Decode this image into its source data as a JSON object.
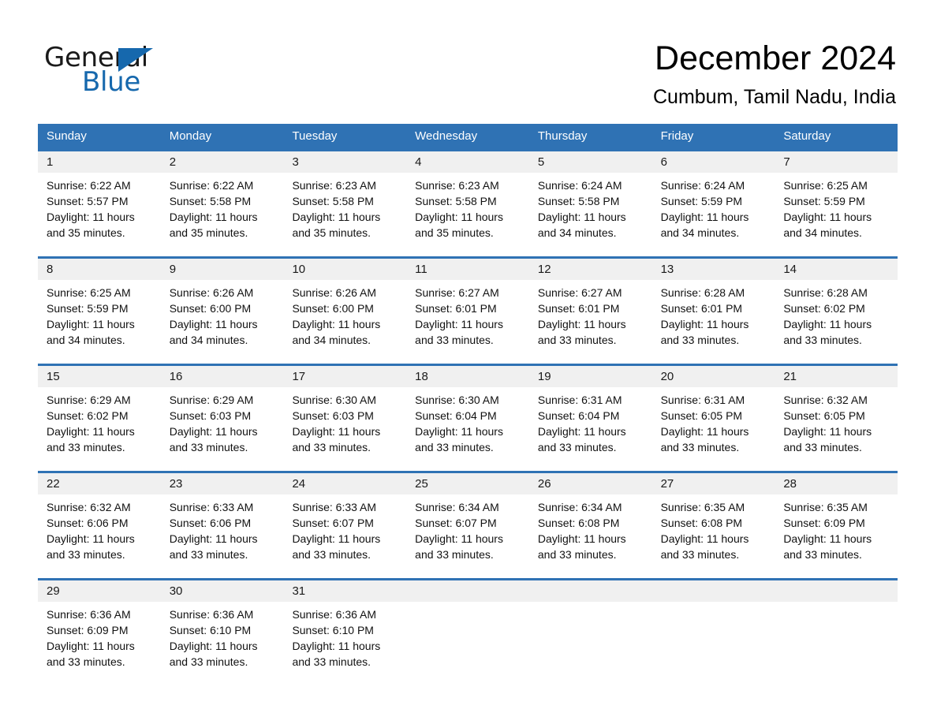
{
  "brand": {
    "name_part1": "General",
    "name_part2": "Blue",
    "triangle_color": "#1668ad"
  },
  "header": {
    "month_title": "December 2024",
    "location": "Cumbum, Tamil Nadu, India"
  },
  "theme": {
    "header_blue": "#2f72b4",
    "date_band_gray": "#f0f0f0",
    "row_divider_blue": "#2f72b4",
    "page_background": "#ffffff"
  },
  "weekdays": [
    "Sunday",
    "Monday",
    "Tuesday",
    "Wednesday",
    "Thursday",
    "Friday",
    "Saturday"
  ],
  "weeks": [
    {
      "days": [
        {
          "date": "1",
          "sunrise": "Sunrise: 6:22 AM",
          "sunset": "Sunset: 5:57 PM",
          "daylight_line1": "Daylight: 11 hours",
          "daylight_line2": "and 35 minutes."
        },
        {
          "date": "2",
          "sunrise": "Sunrise: 6:22 AM",
          "sunset": "Sunset: 5:58 PM",
          "daylight_line1": "Daylight: 11 hours",
          "daylight_line2": "and 35 minutes."
        },
        {
          "date": "3",
          "sunrise": "Sunrise: 6:23 AM",
          "sunset": "Sunset: 5:58 PM",
          "daylight_line1": "Daylight: 11 hours",
          "daylight_line2": "and 35 minutes."
        },
        {
          "date": "4",
          "sunrise": "Sunrise: 6:23 AM",
          "sunset": "Sunset: 5:58 PM",
          "daylight_line1": "Daylight: 11 hours",
          "daylight_line2": "and 35 minutes."
        },
        {
          "date": "5",
          "sunrise": "Sunrise: 6:24 AM",
          "sunset": "Sunset: 5:58 PM",
          "daylight_line1": "Daylight: 11 hours",
          "daylight_line2": "and 34 minutes."
        },
        {
          "date": "6",
          "sunrise": "Sunrise: 6:24 AM",
          "sunset": "Sunset: 5:59 PM",
          "daylight_line1": "Daylight: 11 hours",
          "daylight_line2": "and 34 minutes."
        },
        {
          "date": "7",
          "sunrise": "Sunrise: 6:25 AM",
          "sunset": "Sunset: 5:59 PM",
          "daylight_line1": "Daylight: 11 hours",
          "daylight_line2": "and 34 minutes."
        }
      ]
    },
    {
      "days": [
        {
          "date": "8",
          "sunrise": "Sunrise: 6:25 AM",
          "sunset": "Sunset: 5:59 PM",
          "daylight_line1": "Daylight: 11 hours",
          "daylight_line2": "and 34 minutes."
        },
        {
          "date": "9",
          "sunrise": "Sunrise: 6:26 AM",
          "sunset": "Sunset: 6:00 PM",
          "daylight_line1": "Daylight: 11 hours",
          "daylight_line2": "and 34 minutes."
        },
        {
          "date": "10",
          "sunrise": "Sunrise: 6:26 AM",
          "sunset": "Sunset: 6:00 PM",
          "daylight_line1": "Daylight: 11 hours",
          "daylight_line2": "and 34 minutes."
        },
        {
          "date": "11",
          "sunrise": "Sunrise: 6:27 AM",
          "sunset": "Sunset: 6:01 PM",
          "daylight_line1": "Daylight: 11 hours",
          "daylight_line2": "and 33 minutes."
        },
        {
          "date": "12",
          "sunrise": "Sunrise: 6:27 AM",
          "sunset": "Sunset: 6:01 PM",
          "daylight_line1": "Daylight: 11 hours",
          "daylight_line2": "and 33 minutes."
        },
        {
          "date": "13",
          "sunrise": "Sunrise: 6:28 AM",
          "sunset": "Sunset: 6:01 PM",
          "daylight_line1": "Daylight: 11 hours",
          "daylight_line2": "and 33 minutes."
        },
        {
          "date": "14",
          "sunrise": "Sunrise: 6:28 AM",
          "sunset": "Sunset: 6:02 PM",
          "daylight_line1": "Daylight: 11 hours",
          "daylight_line2": "and 33 minutes."
        }
      ]
    },
    {
      "days": [
        {
          "date": "15",
          "sunrise": "Sunrise: 6:29 AM",
          "sunset": "Sunset: 6:02 PM",
          "daylight_line1": "Daylight: 11 hours",
          "daylight_line2": "and 33 minutes."
        },
        {
          "date": "16",
          "sunrise": "Sunrise: 6:29 AM",
          "sunset": "Sunset: 6:03 PM",
          "daylight_line1": "Daylight: 11 hours",
          "daylight_line2": "and 33 minutes."
        },
        {
          "date": "17",
          "sunrise": "Sunrise: 6:30 AM",
          "sunset": "Sunset: 6:03 PM",
          "daylight_line1": "Daylight: 11 hours",
          "daylight_line2": "and 33 minutes."
        },
        {
          "date": "18",
          "sunrise": "Sunrise: 6:30 AM",
          "sunset": "Sunset: 6:04 PM",
          "daylight_line1": "Daylight: 11 hours",
          "daylight_line2": "and 33 minutes."
        },
        {
          "date": "19",
          "sunrise": "Sunrise: 6:31 AM",
          "sunset": "Sunset: 6:04 PM",
          "daylight_line1": "Daylight: 11 hours",
          "daylight_line2": "and 33 minutes."
        },
        {
          "date": "20",
          "sunrise": "Sunrise: 6:31 AM",
          "sunset": "Sunset: 6:05 PM",
          "daylight_line1": "Daylight: 11 hours",
          "daylight_line2": "and 33 minutes."
        },
        {
          "date": "21",
          "sunrise": "Sunrise: 6:32 AM",
          "sunset": "Sunset: 6:05 PM",
          "daylight_line1": "Daylight: 11 hours",
          "daylight_line2": "and 33 minutes."
        }
      ]
    },
    {
      "days": [
        {
          "date": "22",
          "sunrise": "Sunrise: 6:32 AM",
          "sunset": "Sunset: 6:06 PM",
          "daylight_line1": "Daylight: 11 hours",
          "daylight_line2": "and 33 minutes."
        },
        {
          "date": "23",
          "sunrise": "Sunrise: 6:33 AM",
          "sunset": "Sunset: 6:06 PM",
          "daylight_line1": "Daylight: 11 hours",
          "daylight_line2": "and 33 minutes."
        },
        {
          "date": "24",
          "sunrise": "Sunrise: 6:33 AM",
          "sunset": "Sunset: 6:07 PM",
          "daylight_line1": "Daylight: 11 hours",
          "daylight_line2": "and 33 minutes."
        },
        {
          "date": "25",
          "sunrise": "Sunrise: 6:34 AM",
          "sunset": "Sunset: 6:07 PM",
          "daylight_line1": "Daylight: 11 hours",
          "daylight_line2": "and 33 minutes."
        },
        {
          "date": "26",
          "sunrise": "Sunrise: 6:34 AM",
          "sunset": "Sunset: 6:08 PM",
          "daylight_line1": "Daylight: 11 hours",
          "daylight_line2": "and 33 minutes."
        },
        {
          "date": "27",
          "sunrise": "Sunrise: 6:35 AM",
          "sunset": "Sunset: 6:08 PM",
          "daylight_line1": "Daylight: 11 hours",
          "daylight_line2": "and 33 minutes."
        },
        {
          "date": "28",
          "sunrise": "Sunrise: 6:35 AM",
          "sunset": "Sunset: 6:09 PM",
          "daylight_line1": "Daylight: 11 hours",
          "daylight_line2": "and 33 minutes."
        }
      ]
    },
    {
      "days": [
        {
          "date": "29",
          "sunrise": "Sunrise: 6:36 AM",
          "sunset": "Sunset: 6:09 PM",
          "daylight_line1": "Daylight: 11 hours",
          "daylight_line2": "and 33 minutes."
        },
        {
          "date": "30",
          "sunrise": "Sunrise: 6:36 AM",
          "sunset": "Sunset: 6:10 PM",
          "daylight_line1": "Daylight: 11 hours",
          "daylight_line2": "and 33 minutes."
        },
        {
          "date": "31",
          "sunrise": "Sunrise: 6:36 AM",
          "sunset": "Sunset: 6:10 PM",
          "daylight_line1": "Daylight: 11 hours",
          "daylight_line2": "and 33 minutes."
        },
        {
          "date": "",
          "sunrise": "",
          "sunset": "",
          "daylight_line1": "",
          "daylight_line2": ""
        },
        {
          "date": "",
          "sunrise": "",
          "sunset": "",
          "daylight_line1": "",
          "daylight_line2": ""
        },
        {
          "date": "",
          "sunrise": "",
          "sunset": "",
          "daylight_line1": "",
          "daylight_line2": ""
        },
        {
          "date": "",
          "sunrise": "",
          "sunset": "",
          "daylight_line1": "",
          "daylight_line2": ""
        }
      ]
    }
  ]
}
